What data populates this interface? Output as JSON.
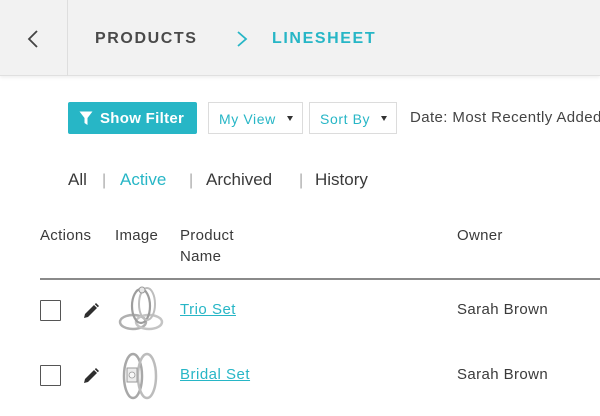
{
  "header": {
    "back_icon": "chevron-left-icon",
    "breadcrumb": {
      "parent": "PRODUCTS",
      "separator_icon": "chevron-right-icon",
      "current": "LINESHEET"
    }
  },
  "toolbar": {
    "filter_icon": "funnel-icon",
    "filter_label": "Show Filter",
    "view_label": "My View",
    "sort_label": "Sort By",
    "date_label": "Date: Most Recently Added"
  },
  "tabs": [
    {
      "label": "All"
    },
    {
      "label": "Active",
      "selected": true
    },
    {
      "label": "Archived"
    },
    {
      "label": "History"
    }
  ],
  "table": {
    "columns": {
      "actions": "Actions",
      "image": "Image",
      "name_line1": "Product",
      "name_line2": "Name",
      "owner": "Owner"
    },
    "rows": [
      {
        "name": "Trio Set",
        "owner": "Sarah Brown",
        "image": "ring-set-thumbnail"
      },
      {
        "name": "Bridal Set",
        "owner": "Sarah Brown",
        "image": "ring-set-thumbnail"
      }
    ]
  },
  "colors": {
    "accent": "#27b6c6",
    "topbar": "#f2f2f2",
    "text": "#3a3a3a"
  }
}
